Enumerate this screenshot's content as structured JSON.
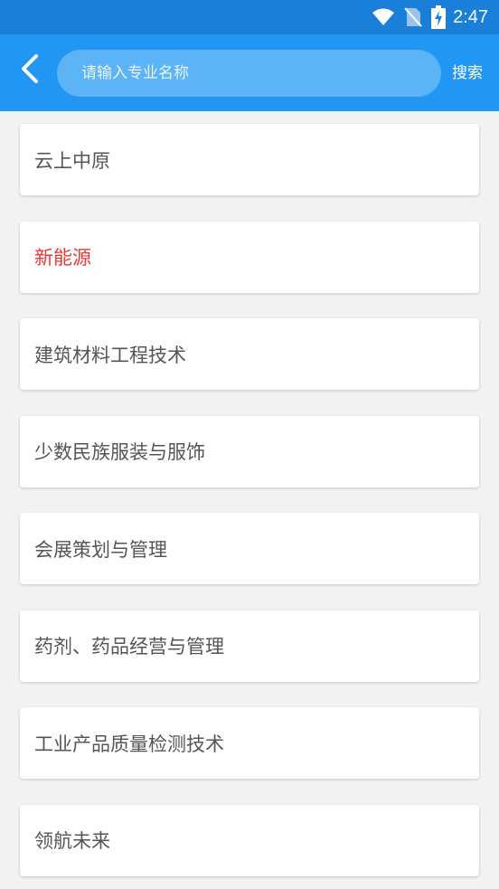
{
  "status_bar": {
    "time": "2:47",
    "icons": [
      "wifi-icon",
      "no-sim-icon",
      "battery-charging-icon"
    ]
  },
  "header": {
    "back_icon": "chevron-left-icon",
    "search_placeholder": "请输入专业名称",
    "search_value": "",
    "search_label": "搜索"
  },
  "colors": {
    "app_bar": "#2196f3",
    "status_bar": "#1a7fd8",
    "highlight_text": "#e53935"
  },
  "majors": [
    {
      "label": "云上中原",
      "highlighted": false
    },
    {
      "label": "新能源",
      "highlighted": true
    },
    {
      "label": "建筑材料工程技术",
      "highlighted": false
    },
    {
      "label": "少数民族服装与服饰",
      "highlighted": false
    },
    {
      "label": "会展策划与管理",
      "highlighted": false
    },
    {
      "label": "药剂、药品经营与管理",
      "highlighted": false
    },
    {
      "label": "工业产品质量检测技术",
      "highlighted": false
    },
    {
      "label": "领航未来",
      "highlighted": false
    }
  ]
}
